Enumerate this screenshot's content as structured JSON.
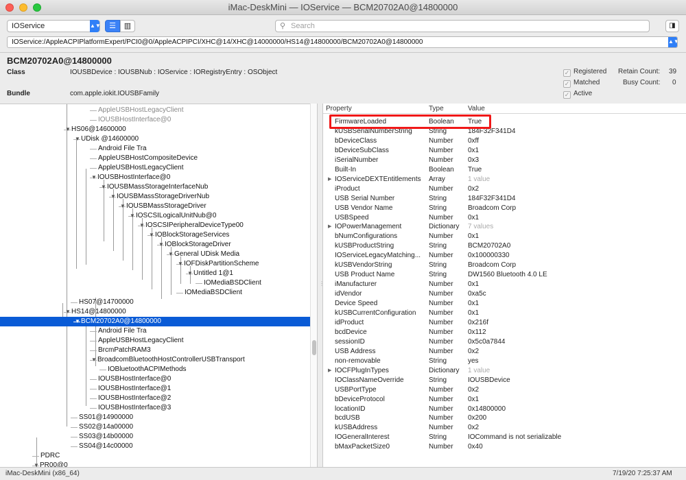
{
  "window": {
    "title": "iMac-DeskMini — IOService — BCM20702A0@14800000"
  },
  "toolbar": {
    "plane": "IOService",
    "search_placeholder": "Search",
    "path": "IOService:/AppleACPIPlatformExpert/PCI0@0/AppleACPIPCI/XHC@14/XHC@14000000/HS14@14800000/BCM20702A0@14800000"
  },
  "info": {
    "title": "BCM20702A0@14800000",
    "class_label": "Class",
    "class_value": "IOUSBDevice : IOUSBNub : IOService : IORegistryEntry : OSObject",
    "bundle_label": "Bundle",
    "bundle_value": "com.apple.iokit.IOUSBFamily",
    "registered": "Registered",
    "matched": "Matched",
    "active": "Active",
    "retain_label": "Retain Count:",
    "retain_value": "39",
    "busy_label": "Busy Count:",
    "busy_value": "0"
  },
  "tree": {
    "rows": [
      {
        "label": "AppleUSBHostLegacyClient",
        "arrow": ""
      },
      {
        "label": "IOUSBHostInterface@0",
        "arrow": ""
      },
      {
        "label": "HS06@14600000",
        "arrow": "▼"
      },
      {
        "label": "UDisk         @14600000",
        "arrow": "▼"
      },
      {
        "label": "Android File Tra",
        "arrow": ""
      },
      {
        "label": "AppleUSBHostCompositeDevice",
        "arrow": ""
      },
      {
        "label": "AppleUSBHostLegacyClient",
        "arrow": ""
      },
      {
        "label": "IOUSBHostInterface@0",
        "arrow": "▼"
      },
      {
        "label": "IOUSBMassStorageInterfaceNub",
        "arrow": "▼"
      },
      {
        "label": "IOUSBMassStorageDriverNub",
        "arrow": "▼"
      },
      {
        "label": "IOUSBMassStorageDriver",
        "arrow": "▼"
      },
      {
        "label": "IOSCSILogicalUnitNub@0",
        "arrow": "▼"
      },
      {
        "label": "IOSCSIPeripheralDeviceType00",
        "arrow": "▼"
      },
      {
        "label": "IOBlockStorageServices",
        "arrow": "▼"
      },
      {
        "label": "IOBlockStorageDriver",
        "arrow": "▼"
      },
      {
        "label": "General UDisk Media",
        "arrow": "▼"
      },
      {
        "label": "IOFDiskPartitionScheme",
        "arrow": "▼"
      },
      {
        "label": "Untitled 1@1",
        "arrow": "▼"
      },
      {
        "label": "IOMediaBSDClient",
        "arrow": ""
      },
      {
        "label": "IOMediaBSDClient",
        "arrow": ""
      },
      {
        "label": "HS07@14700000",
        "arrow": ""
      },
      {
        "label": "HS14@14800000",
        "arrow": "▼"
      },
      {
        "label": "BCM20702A0@14800000",
        "arrow": "▼"
      },
      {
        "label": "Android File Tra",
        "arrow": ""
      },
      {
        "label": "AppleUSBHostLegacyClient",
        "arrow": ""
      },
      {
        "label": "BrcmPatchRAM3",
        "arrow": ""
      },
      {
        "label": "BroadcomBluetoothHostControllerUSBTransport",
        "arrow": "▼"
      },
      {
        "label": "IOBluetoothACPIMethods",
        "arrow": ""
      },
      {
        "label": "IOUSBHostInterface@0",
        "arrow": ""
      },
      {
        "label": "IOUSBHostInterface@1",
        "arrow": ""
      },
      {
        "label": "IOUSBHostInterface@2",
        "arrow": ""
      },
      {
        "label": "IOUSBHostInterface@3",
        "arrow": ""
      },
      {
        "label": "SS01@14900000",
        "arrow": ""
      },
      {
        "label": "SS02@14a00000",
        "arrow": ""
      },
      {
        "label": "SS03@14b00000",
        "arrow": ""
      },
      {
        "label": "SS04@14c00000",
        "arrow": ""
      },
      {
        "label": "PDRC",
        "arrow": ""
      },
      {
        "label": "PR00@0",
        "arrow": "▼"
      }
    ]
  },
  "properties": {
    "headers": {
      "property": "Property",
      "type": "Type",
      "value": "Value"
    },
    "rows": [
      {
        "p": "FirmwareLoaded",
        "t": "Boolean",
        "v": "True",
        "exp": "",
        "dim": false
      },
      {
        "p": "kUSBSerialNumberString",
        "t": "String",
        "v": "184F32F341D4",
        "exp": "",
        "dim": false
      },
      {
        "p": "bDeviceClass",
        "t": "Number",
        "v": "0xff",
        "exp": "",
        "dim": false
      },
      {
        "p": "bDeviceSubClass",
        "t": "Number",
        "v": "0x1",
        "exp": "",
        "dim": false
      },
      {
        "p": "iSerialNumber",
        "t": "Number",
        "v": "0x3",
        "exp": "",
        "dim": false
      },
      {
        "p": "Built-In",
        "t": "Boolean",
        "v": "True",
        "exp": "",
        "dim": false
      },
      {
        "p": "IOServiceDEXTEntitlements",
        "t": "Array",
        "v": "1 value",
        "exp": "▶",
        "dim": true
      },
      {
        "p": "iProduct",
        "t": "Number",
        "v": "0x2",
        "exp": "",
        "dim": false
      },
      {
        "p": "USB Serial Number",
        "t": "String",
        "v": "184F32F341D4",
        "exp": "",
        "dim": false
      },
      {
        "p": "USB Vendor Name",
        "t": "String",
        "v": "Broadcom Corp",
        "exp": "",
        "dim": false
      },
      {
        "p": "USBSpeed",
        "t": "Number",
        "v": "0x1",
        "exp": "",
        "dim": false
      },
      {
        "p": "IOPowerManagement",
        "t": "Dictionary",
        "v": "7 values",
        "exp": "▶",
        "dim": true
      },
      {
        "p": "bNumConfigurations",
        "t": "Number",
        "v": "0x1",
        "exp": "",
        "dim": false
      },
      {
        "p": "kUSBProductString",
        "t": "String",
        "v": "BCM20702A0",
        "exp": "",
        "dim": false
      },
      {
        "p": "IOServiceLegacyMatching...",
        "t": "Number",
        "v": "0x100000330",
        "exp": "",
        "dim": false
      },
      {
        "p": "kUSBVendorString",
        "t": "String",
        "v": "Broadcom Corp",
        "exp": "",
        "dim": false
      },
      {
        "p": "USB Product Name",
        "t": "String",
        "v": "DW1560 Bluetooth 4.0 LE",
        "exp": "",
        "dim": false
      },
      {
        "p": "iManufacturer",
        "t": "Number",
        "v": "0x1",
        "exp": "",
        "dim": false
      },
      {
        "p": "idVendor",
        "t": "Number",
        "v": "0xa5c",
        "exp": "",
        "dim": false
      },
      {
        "p": "Device Speed",
        "t": "Number",
        "v": "0x1",
        "exp": "",
        "dim": false
      },
      {
        "p": "kUSBCurrentConfiguration",
        "t": "Number",
        "v": "0x1",
        "exp": "",
        "dim": false
      },
      {
        "p": "idProduct",
        "t": "Number",
        "v": "0x216f",
        "exp": "",
        "dim": false
      },
      {
        "p": "bcdDevice",
        "t": "Number",
        "v": "0x112",
        "exp": "",
        "dim": false
      },
      {
        "p": "sessionID",
        "t": "Number",
        "v": "0x5c0a7844",
        "exp": "",
        "dim": false
      },
      {
        "p": "USB Address",
        "t": "Number",
        "v": "0x2",
        "exp": "",
        "dim": false
      },
      {
        "p": "non-removable",
        "t": "String",
        "v": "yes",
        "exp": "",
        "dim": false
      },
      {
        "p": "IOCFPlugInTypes",
        "t": "Dictionary",
        "v": "1 value",
        "exp": "▶",
        "dim": true
      },
      {
        "p": "IOClassNameOverride",
        "t": "String",
        "v": "IOUSBDevice",
        "exp": "",
        "dim": false
      },
      {
        "p": "USBPortType",
        "t": "Number",
        "v": "0x2",
        "exp": "",
        "dim": false
      },
      {
        "p": "bDeviceProtocol",
        "t": "Number",
        "v": "0x1",
        "exp": "",
        "dim": false
      },
      {
        "p": "locationID",
        "t": "Number",
        "v": "0x14800000",
        "exp": "",
        "dim": false
      },
      {
        "p": "bcdUSB",
        "t": "Number",
        "v": "0x200",
        "exp": "",
        "dim": false
      },
      {
        "p": "kUSBAddress",
        "t": "Number",
        "v": "0x2",
        "exp": "",
        "dim": false
      },
      {
        "p": "IOGeneralInterest",
        "t": "String",
        "v": "IOCommand is not serializable",
        "exp": "",
        "dim": false
      },
      {
        "p": "bMaxPacketSize0",
        "t": "Number",
        "v": "0x40",
        "exp": "",
        "dim": false
      }
    ]
  },
  "status": {
    "host": "iMac-DeskMini (x86_64)",
    "time": "7/19/20 7:25:37 AM"
  },
  "colors": {
    "selection": "#0a5bd6",
    "highlight": "#f01818",
    "accent": "#2f7ff7"
  }
}
